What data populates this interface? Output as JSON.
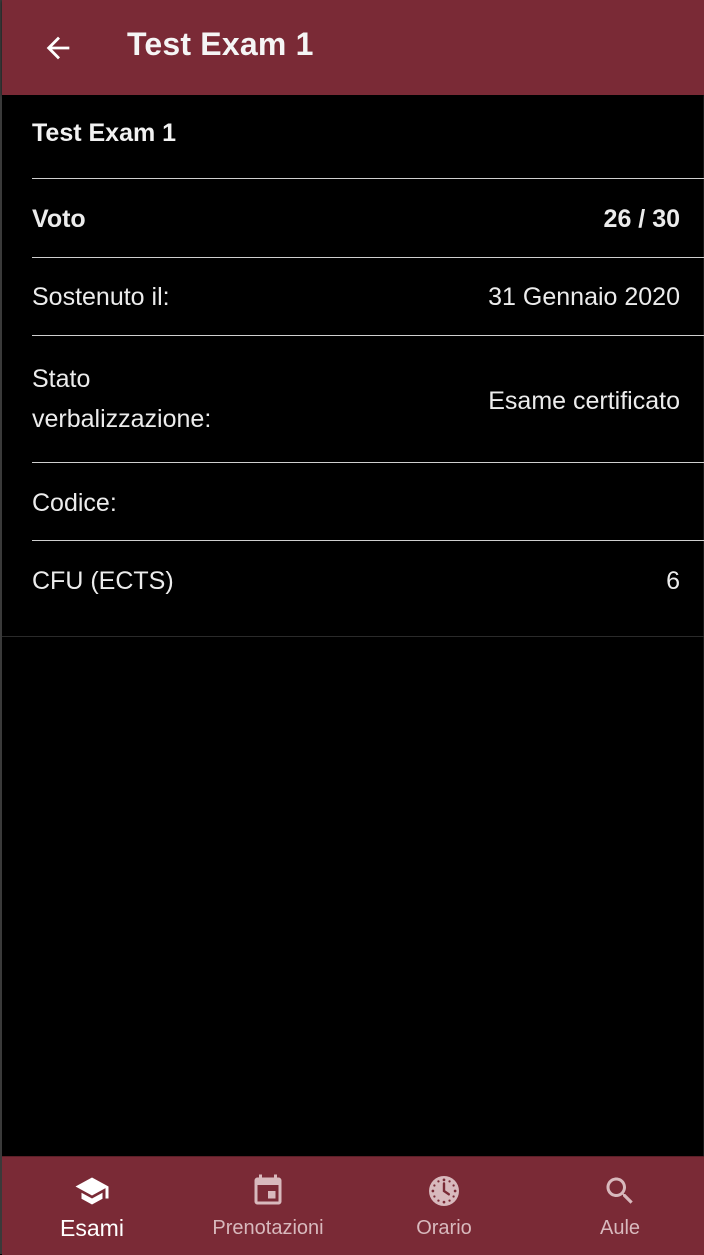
{
  "appbar": {
    "title": "Test Exam 1",
    "back_icon": "arrow-back-icon"
  },
  "exam": {
    "name": "Test Exam 1",
    "rows": [
      {
        "label": "Voto",
        "value": "26 / 30",
        "bold": true
      },
      {
        "label": "Sostenuto il:",
        "value": "31 Gennaio 2020"
      },
      {
        "label_line1": "Stato",
        "label_line2": "verbalizzazione:",
        "value": "Esame certificato"
      },
      {
        "label": "Codice:",
        "value": ""
      },
      {
        "label": "CFU (ECTS)",
        "value": "6"
      }
    ]
  },
  "bottom_nav": {
    "items": [
      {
        "label": "Esami",
        "icon": "graduation-cap-icon",
        "active": true
      },
      {
        "label": "Prenotazioni",
        "icon": "calendar-icon",
        "active": false
      },
      {
        "label": "Orario",
        "icon": "clock-icon",
        "active": false
      },
      {
        "label": "Aule",
        "icon": "search-icon",
        "active": false
      }
    ]
  },
  "colors": {
    "primary": "#7a2a36",
    "background": "#000000",
    "text": "#ececec",
    "nav_inactive": "#d8b9bd"
  }
}
